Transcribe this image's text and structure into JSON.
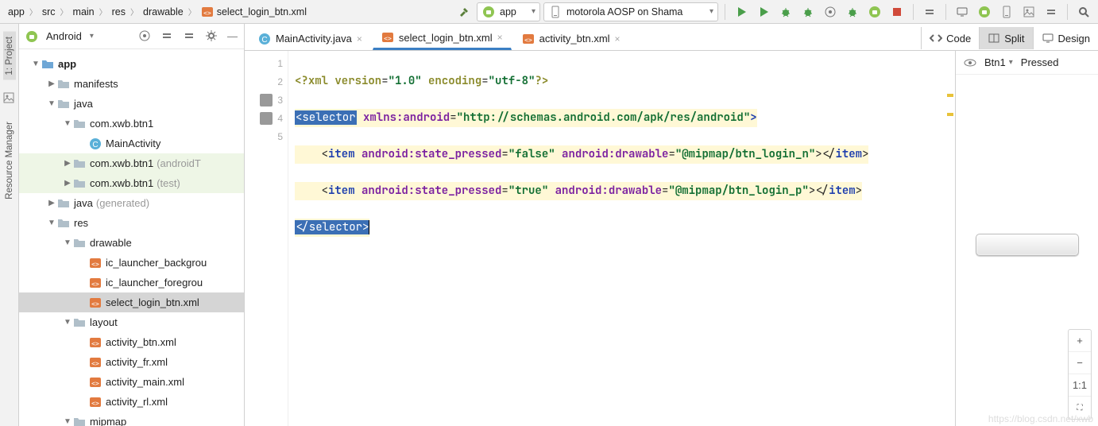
{
  "breadcrumbs": [
    "app",
    "src",
    "main",
    "res",
    "drawable",
    "select_login_btn.xml"
  ],
  "run_config": "app",
  "device": "motorola AOSP on Shama",
  "project_tool": {
    "title": "Android"
  },
  "left_tabs": {
    "t1": "1: Project",
    "t2": "Resource Manager"
  },
  "tree": {
    "app": "app",
    "manifests": "manifests",
    "java": "java",
    "pkg1": "com.xwb.btn1",
    "main_activity": "MainActivity",
    "pkg2": "com.xwb.btn1",
    "pkg2_suffix": "(androidT",
    "pkg3": "com.xwb.btn1",
    "pkg3_suffix": "(test)",
    "java_gen": "java",
    "java_gen_suffix": "(generated)",
    "res": "res",
    "drawable": "drawable",
    "ic_bg": "ic_launcher_backgrou",
    "ic_fg": "ic_launcher_foregrou",
    "sel_login": "select_login_btn.xml",
    "layout": "layout",
    "act_btn": "activity_btn.xml",
    "act_fr": "activity_fr.xml",
    "act_main": "activity_main.xml",
    "act_rl": "activity_rl.xml",
    "mipmap": "mipmap"
  },
  "tabs": {
    "t1": "MainActivity.java",
    "t2": "select_login_btn.xml",
    "t3": "activity_btn.xml"
  },
  "modes": {
    "code": "Code",
    "split": "Split",
    "design": "Design"
  },
  "code": {
    "l1_a": "<?",
    "l1_b": "xml version",
    "l1_c": "=",
    "l1_d": "\"1.0\"",
    "l1_e": " encoding",
    "l1_f": "=",
    "l1_g": "\"utf-8\"",
    "l1_h": "?>",
    "l2_a": "<selector",
    "l2_b": " xmlns:android",
    "l2_c": "=",
    "l2_d": "\"http://schemas.android.com/apk/res/android\"",
    "l2_e": ">",
    "l3_a": "    <",
    "l3_b": "item",
    "l3_c": " android:state_pressed",
    "l3_d": "=",
    "l3_e": "\"false\"",
    "l3_f": " android:drawable",
    "l3_g": "=",
    "l3_h": "\"@mipmap/btn_login_n\"",
    "l3_i": "></",
    "l3_j": "item",
    "l3_k": ">",
    "l4_a": "    <",
    "l4_b": "item",
    "l4_c": " android:state_pressed",
    "l4_d": "=",
    "l4_e": "\"true\"",
    "l4_f": " android:drawable",
    "l4_g": "=",
    "l4_h": "\"@mipmap/btn_login_p\"",
    "l4_i": "></",
    "l4_j": "item",
    "l4_k": ">",
    "l5_a": "</selector>"
  },
  "line_numbers": [
    "1",
    "2",
    "3",
    "4",
    "5"
  ],
  "preview": {
    "variant": "Btn1",
    "state": "Pressed",
    "zoom_plus": "+",
    "zoom_minus": "−",
    "zoom_11": "1:1",
    "zoom_fit": "⛶"
  },
  "watermark": "https://blog.csdn.net/xwb"
}
